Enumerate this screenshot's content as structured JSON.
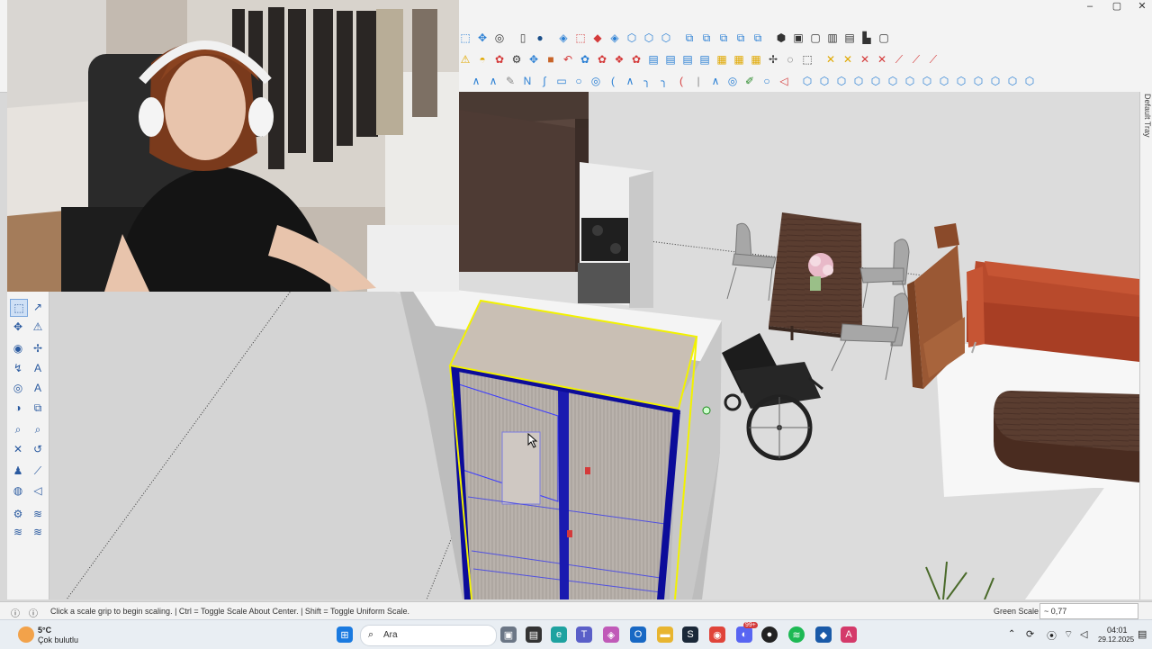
{
  "window": {
    "minimize": "–",
    "maximize": "▢",
    "close": "✕"
  },
  "toolbar": {
    "row1": [
      {
        "name": "select-tool",
        "glyph": "⬚",
        "color": "#2a7fd4"
      },
      {
        "name": "pan-tool",
        "glyph": "✥",
        "color": "#2a7fd4"
      },
      {
        "name": "orbit-tool",
        "glyph": "◎",
        "color": "#333333"
      },
      {
        "sep": true
      },
      {
        "name": "new-file",
        "glyph": "▯",
        "color": "#444444"
      },
      {
        "name": "user-profile",
        "glyph": "●",
        "color": "#1b4f8a"
      },
      {
        "sep": true
      },
      {
        "name": "paint-bucket",
        "glyph": "◈",
        "color": "#2a7fd4"
      },
      {
        "name": "component",
        "glyph": "⬚",
        "color": "#d43a3a"
      },
      {
        "name": "move-red",
        "glyph": "◆",
        "color": "#d43a3a"
      },
      {
        "name": "rotate",
        "glyph": "◈",
        "color": "#2a7fd4"
      },
      {
        "name": "box-iso",
        "glyph": "⬡",
        "color": "#2a7fd4"
      },
      {
        "name": "box-iso-2",
        "glyph": "⬡",
        "color": "#2a7fd4"
      },
      {
        "name": "box-iso-3",
        "glyph": "⬡",
        "color": "#2a7fd4"
      },
      {
        "sep": true
      },
      {
        "name": "view-1",
        "glyph": "⧉",
        "color": "#2a7fd4"
      },
      {
        "name": "view-2",
        "glyph": "⧉",
        "color": "#2a7fd4"
      },
      {
        "name": "view-3",
        "glyph": "⧉",
        "color": "#2a7fd4"
      },
      {
        "name": "view-4",
        "glyph": "⧉",
        "color": "#2a7fd4"
      },
      {
        "name": "view-5",
        "glyph": "⧉",
        "color": "#2a7fd4"
      },
      {
        "sep": true
      },
      {
        "name": "iso-view",
        "glyph": "⬢",
        "color": "#333333"
      },
      {
        "name": "top-view",
        "glyph": "▣",
        "color": "#333333"
      },
      {
        "name": "front-view",
        "glyph": "▢",
        "color": "#333333"
      },
      {
        "name": "right-view",
        "glyph": "▥",
        "color": "#333333"
      },
      {
        "name": "back-view",
        "glyph": "▤",
        "color": "#333333"
      },
      {
        "name": "left-view",
        "glyph": "▙",
        "color": "#333333"
      },
      {
        "name": "bottom-view",
        "glyph": "▢",
        "color": "#333333"
      }
    ],
    "row2": [
      {
        "name": "warning",
        "glyph": "⚠",
        "color": "#e0a800"
      },
      {
        "name": "lasso",
        "glyph": "◓",
        "color": "#e0a800"
      },
      {
        "name": "sandbox",
        "glyph": "✿",
        "color": "#d43a3a"
      },
      {
        "name": "gear",
        "glyph": "⚙",
        "color": "#333333"
      },
      {
        "name": "move",
        "glyph": "✥",
        "color": "#2a7fd4"
      },
      {
        "name": "material",
        "glyph": "■",
        "color": "#c86428"
      },
      {
        "name": "undo",
        "glyph": "↶",
        "color": "#d43a3a"
      },
      {
        "name": "tool-8",
        "glyph": "✿",
        "color": "#2a7fd4"
      },
      {
        "name": "tool-9",
        "glyph": "✿",
        "color": "#d43a3a"
      },
      {
        "name": "tool-10",
        "glyph": "❖",
        "color": "#d43a3a"
      },
      {
        "name": "tool-11",
        "glyph": "✿",
        "color": "#d43a3a"
      },
      {
        "name": "tool-12",
        "glyph": "▤",
        "color": "#2a7fd4"
      },
      {
        "name": "tool-13",
        "glyph": "▤",
        "color": "#2a7fd4"
      },
      {
        "name": "tool-14",
        "glyph": "▤",
        "color": "#2a7fd4"
      },
      {
        "name": "tool-15",
        "glyph": "▤",
        "color": "#2a7fd4"
      },
      {
        "name": "tool-16",
        "glyph": "▦",
        "color": "#e0a800"
      },
      {
        "name": "tool-17",
        "glyph": "▦",
        "color": "#e0a800"
      },
      {
        "name": "tool-18",
        "glyph": "▦",
        "color": "#e0a800"
      },
      {
        "name": "tool-19",
        "glyph": "✢",
        "color": "#333333"
      },
      {
        "name": "tool-20",
        "glyph": "◌",
        "color": "#333333"
      },
      {
        "name": "tool-21",
        "glyph": "⬚",
        "color": "#333333"
      },
      {
        "sep": true
      },
      {
        "name": "tool-22",
        "glyph": "✕",
        "color": "#e0a800"
      },
      {
        "name": "tool-23",
        "glyph": "✕",
        "color": "#e0a800"
      },
      {
        "name": "tool-24",
        "glyph": "✕",
        "color": "#d43a3a"
      },
      {
        "name": "tool-25",
        "glyph": "✕",
        "color": "#d43a3a"
      },
      {
        "name": "tool-26",
        "glyph": "⟋",
        "color": "#d43a3a"
      },
      {
        "name": "tool-27",
        "glyph": "⟋",
        "color": "#d43a3a"
      },
      {
        "name": "tool-28",
        "glyph": "⟋",
        "color": "#d43a3a"
      }
    ],
    "row3": [
      {
        "name": "freehand",
        "glyph": "∧",
        "color": "#2a7fd4"
      },
      {
        "name": "line",
        "glyph": "∧",
        "color": "#2a7fd4"
      },
      {
        "name": "eraser",
        "glyph": "✎",
        "color": "#888888"
      },
      {
        "name": "arc",
        "glyph": "N",
        "color": "#2a7fd4"
      },
      {
        "name": "curve",
        "glyph": "∫",
        "color": "#2a7fd4"
      },
      {
        "name": "rectangle",
        "glyph": "▭",
        "color": "#2a7fd4"
      },
      {
        "name": "circle",
        "glyph": "○",
        "color": "#2a7fd4"
      },
      {
        "name": "polygon",
        "glyph": "◎",
        "color": "#2a7fd4"
      },
      {
        "name": "arc-2",
        "glyph": "(",
        "color": "#2a7fd4"
      },
      {
        "name": "bezier",
        "glyph": "∧",
        "color": "#2a7fd4"
      },
      {
        "name": "arc-3",
        "glyph": "╮",
        "color": "#2a7fd4"
      },
      {
        "name": "arc-4",
        "glyph": "╮",
        "color": "#2a7fd4"
      },
      {
        "name": "arc-5",
        "glyph": "(",
        "color": "#d43a3a"
      },
      {
        "name": "line-2",
        "glyph": "|",
        "color": "#888888"
      },
      {
        "name": "bezier-2",
        "glyph": "∧",
        "color": "#2a7fd4"
      },
      {
        "name": "ring",
        "glyph": "◎",
        "color": "#2a7fd4"
      },
      {
        "name": "wrench",
        "glyph": "✐",
        "color": "#2a8a2a"
      },
      {
        "name": "ellipse",
        "glyph": "○",
        "color": "#2a7fd4"
      },
      {
        "name": "cone",
        "glyph": "◁",
        "color": "#d43a3a"
      },
      {
        "sep": true
      },
      {
        "name": "3d-1",
        "glyph": "⬡",
        "color": "#2a7fd4"
      },
      {
        "name": "3d-2",
        "glyph": "⬡",
        "color": "#2a7fd4"
      },
      {
        "name": "3d-3",
        "glyph": "⬡",
        "color": "#2a7fd4"
      },
      {
        "name": "3d-4",
        "glyph": "⬡",
        "color": "#2a7fd4"
      },
      {
        "name": "3d-5",
        "glyph": "⬡",
        "color": "#2a7fd4"
      },
      {
        "name": "3d-6",
        "glyph": "⬡",
        "color": "#2a7fd4"
      },
      {
        "name": "3d-7",
        "glyph": "⬡",
        "color": "#2a7fd4"
      },
      {
        "name": "3d-8",
        "glyph": "⬡",
        "color": "#2a7fd4"
      },
      {
        "name": "3d-9",
        "glyph": "⬡",
        "color": "#2a7fd4"
      },
      {
        "name": "3d-10",
        "glyph": "⬡",
        "color": "#2a7fd4"
      },
      {
        "name": "3d-11",
        "glyph": "⬡",
        "color": "#2a7fd4"
      },
      {
        "name": "3d-12",
        "glyph": "⬡",
        "color": "#2a7fd4"
      },
      {
        "name": "3d-13",
        "glyph": "⬡",
        "color": "#2a7fd4"
      },
      {
        "name": "3d-14",
        "glyph": "⬡",
        "color": "#2a7fd4"
      }
    ]
  },
  "left_tools": [
    "scale-tool-icon",
    "follow-me-icon",
    "move-icon",
    "warning-icon",
    "paint-icon",
    "tape-icon",
    "offset-icon",
    "text-icon",
    "orbit-icon",
    "3d-text-icon",
    "rotate-icon",
    "push-pull-icon",
    "zoom-icon",
    "zoom-window-icon",
    "zoom-extents-icon",
    "walk-icon",
    "look-around-icon",
    "section-icon",
    "eye-icon",
    "position-camera-icon",
    "gear-icon",
    "layers-icon",
    "components-icon",
    "materials-icon"
  ],
  "tray": {
    "label": "Default Tray"
  },
  "status": {
    "message": "Click a scale grip to begin scaling.  |  Ctrl = Toggle Scale About Center.  |  Shift = Toggle Uniform Scale.",
    "measurement_label": "Green Scale",
    "measurement_value": "~ 0,77"
  },
  "taskbar": {
    "weather_temp": "5°C",
    "weather_desc": "Çok bulutlu",
    "search_placeholder": "Ara",
    "time": "04:01",
    "date": "29.12.2025",
    "badge": "99+"
  }
}
